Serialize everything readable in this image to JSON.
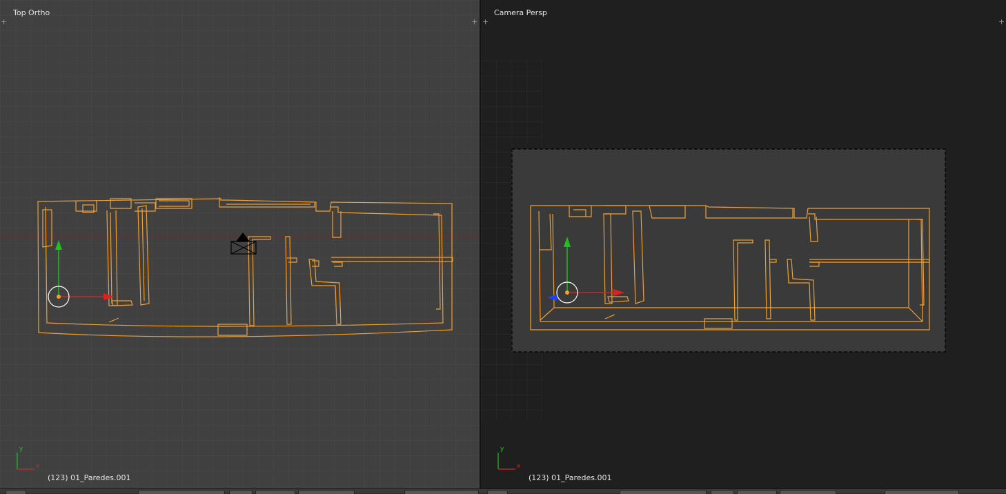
{
  "left_viewport": {
    "title": "Top Ortho",
    "status": "(123) 01_Paredes.001",
    "axis_y_label": "y",
    "axis_x_label": "x"
  },
  "right_viewport": {
    "title": "Camera Persp",
    "status": "(123) 01_Paredes.001",
    "axis_y_label": "y",
    "axis_x_label": "x"
  },
  "colors": {
    "selection": "#f0a030",
    "axis_x": "#e02020",
    "axis_y": "#20c020",
    "axis_z": "#2040ff",
    "grid_ortho": "#4a4a4a",
    "camera_frame_bg": "#3a3a3a",
    "viewport_ortho_bg": "#404040",
    "viewport_persp_bg": "#1f1f1f"
  },
  "icons": {
    "corner_plus": "+",
    "origin_widget": "3d-cursor-icon",
    "camera": "camera-object-icon"
  }
}
